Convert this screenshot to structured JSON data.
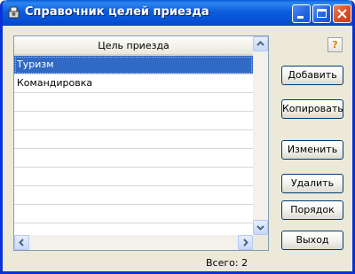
{
  "window": {
    "title": "Справочник целей приезда"
  },
  "icons": {
    "app": "gear-icon",
    "minimize": "minimize-icon",
    "maximize": "maximize-icon",
    "close": "close-icon",
    "help": "help-icon"
  },
  "help_label": "?",
  "grid": {
    "column_header": "Цель приезда",
    "rows": [
      "Туризм",
      "Командировка",
      "",
      "",
      "",
      "",
      "",
      "",
      "",
      ""
    ],
    "selected_row": 0
  },
  "buttons": {
    "add": "Добавить",
    "copy": "Копировать",
    "edit": "Изменить",
    "delete": "Удалить",
    "order": "Порядок",
    "exit": "Выход"
  },
  "status": {
    "total": "Всего: 2"
  }
}
